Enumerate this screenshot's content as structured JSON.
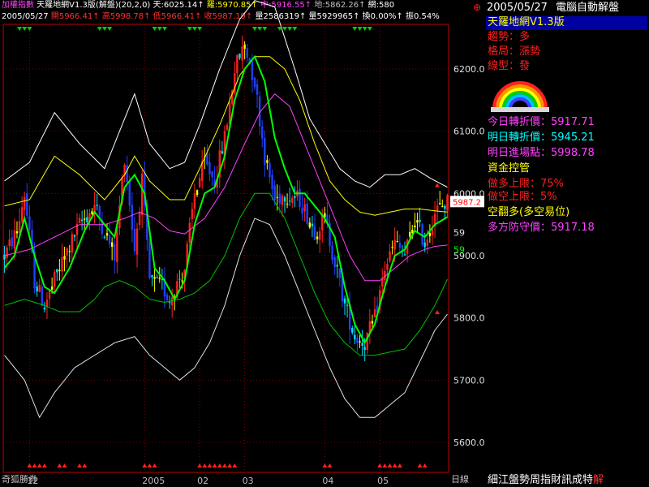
{
  "header": {
    "row1": [
      {
        "text": "加權指數",
        "cls": "c-mag"
      },
      {
        "text": " 天羅地網V1.3版(解盤)(20,2,0) ",
        "cls": "t"
      },
      {
        "text": "天:6025.14↑ ",
        "cls": "t"
      },
      {
        "text": "羅:5970.85↑ ",
        "cls": "c-yel"
      },
      {
        "text": "中:5916.55↑ ",
        "cls": "c-mag"
      },
      {
        "text": "地:5862.26↑ ",
        "cls": "c-gry"
      },
      {
        "text": "網:580",
        "cls": "t"
      }
    ],
    "row2": [
      {
        "text": "2005/05/27 ",
        "cls": "t"
      },
      {
        "text": "開5966.41↑ 高5998.78↑ 低5966.41↑ 收5987.19↑ ",
        "cls": "c-red"
      },
      {
        "text": "量2586319↑ 量5929965↑ 換0.00%↑ 振0.54%",
        "cls": "t"
      }
    ]
  },
  "panel": {
    "date": "2005/05/27",
    "brand": "電腦自動解盤",
    "title": "天羅地網V1.3版",
    "trend": "趨勢：多",
    "pattern": "格局：漲勢",
    "line_type": "線型：發",
    "today_turn": "今日轉折價：5917.71",
    "tomorrow_turn": "明日轉折價：5945.21",
    "tomorrow_entry": "明日進場點：5998.78",
    "capital": "資金控管",
    "long_limit": "做多上限：75%",
    "short_limit": "做空上限：5%",
    "flip": "空翻多(多空易位)",
    "defense": "多方防守價：5917.18"
  },
  "footer": {
    "left": "奇狐勝券",
    "unit": "日線",
    "slogan": "細江盤勢周指財訊成特",
    "slogan_last": "解"
  },
  "colors": {
    "up": "#ff2020",
    "down": "#2040ff",
    "doji_up": "#ffff00",
    "doji_down": "#00e0ff",
    "grid": "#800000",
    "axis": "#c00000"
  },
  "chart_data": {
    "type": "line",
    "title": "",
    "xlabel": "",
    "ylabel": "",
    "ylim": [
      5560,
      6260
    ],
    "yticks": [
      5600,
      5700,
      5800,
      5900,
      6000,
      6100,
      6200
    ],
    "ytick_labels": [
      "5600.0",
      "5700.0",
      "5800.0",
      "5900.0",
      "6000.0",
      "6100.0",
      "6200.0"
    ],
    "xticks": [
      {
        "index": 10,
        "label": "12"
      },
      {
        "index": 56,
        "label": "2005"
      },
      {
        "index": 78,
        "label": "02"
      },
      {
        "index": 96,
        "label": "03"
      },
      {
        "index": 128,
        "label": "04"
      },
      {
        "index": 150,
        "label": "05"
      }
    ],
    "n_bars": 178,
    "last_close_label": "5987.2",
    "right_labels": [
      {
        "value": 5937,
        "text": "59"
      },
      {
        "value": 5910,
        "text": "59"
      }
    ],
    "anchors": [
      [
        0,
        5900
      ],
      [
        5,
        5940
      ],
      [
        8,
        6000
      ],
      [
        12,
        5860
      ],
      [
        16,
        5820
      ],
      [
        22,
        5880
      ],
      [
        30,
        5950
      ],
      [
        36,
        5980
      ],
      [
        44,
        5900
      ],
      [
        48,
        6060
      ],
      [
        52,
        5910
      ],
      [
        55,
        6020
      ],
      [
        58,
        5860
      ],
      [
        63,
        5850
      ],
      [
        66,
        5830
      ],
      [
        72,
        5880
      ],
      [
        76,
        6000
      ],
      [
        80,
        6050
      ],
      [
        84,
        6020
      ],
      [
        88,
        6090
      ],
      [
        92,
        6200
      ],
      [
        96,
        6240
      ],
      [
        100,
        6180
      ],
      [
        104,
        6060
      ],
      [
        108,
        5990
      ],
      [
        112,
        6000
      ],
      [
        118,
        5990
      ],
      [
        124,
        5940
      ],
      [
        128,
        5960
      ],
      [
        132,
        5890
      ],
      [
        136,
        5820
      ],
      [
        140,
        5770
      ],
      [
        144,
        5760
      ],
      [
        148,
        5800
      ],
      [
        152,
        5880
      ],
      [
        156,
        5920
      ],
      [
        160,
        5900
      ],
      [
        164,
        5960
      ],
      [
        168,
        5920
      ],
      [
        172,
        5970
      ],
      [
        177,
        5987
      ]
    ],
    "series": [
      {
        "name": "天",
        "color": "#ffffff",
        "points": [
          [
            0,
            6020
          ],
          [
            10,
            6050
          ],
          [
            20,
            6130
          ],
          [
            30,
            6080
          ],
          [
            40,
            6040
          ],
          [
            48,
            6120
          ],
          [
            52,
            6160
          ],
          [
            58,
            6080
          ],
          [
            66,
            6040
          ],
          [
            72,
            6050
          ],
          [
            78,
            6110
          ],
          [
            86,
            6200
          ],
          [
            94,
            6280
          ],
          [
            100,
            6310
          ],
          [
            108,
            6300
          ],
          [
            116,
            6200
          ],
          [
            122,
            6120
          ],
          [
            128,
            6080
          ],
          [
            134,
            6040
          ],
          [
            140,
            6020
          ],
          [
            146,
            6010
          ],
          [
            152,
            6030
          ],
          [
            158,
            6030
          ],
          [
            164,
            6040
          ],
          [
            170,
            6025
          ],
          [
            177,
            6010
          ]
        ]
      },
      {
        "name": "羅",
        "color": "#ffff00",
        "points": [
          [
            0,
            5980
          ],
          [
            10,
            5990
          ],
          [
            20,
            6060
          ],
          [
            30,
            6030
          ],
          [
            40,
            5990
          ],
          [
            48,
            6030
          ],
          [
            52,
            6060
          ],
          [
            58,
            6020
          ],
          [
            66,
            5990
          ],
          [
            72,
            5990
          ],
          [
            78,
            6040
          ],
          [
            86,
            6110
          ],
          [
            94,
            6190
          ],
          [
            100,
            6220
          ],
          [
            106,
            6220
          ],
          [
            112,
            6200
          ],
          [
            118,
            6150
          ],
          [
            124,
            6080
          ],
          [
            130,
            6020
          ],
          [
            136,
            5990
          ],
          [
            142,
            5970
          ],
          [
            148,
            5965
          ],
          [
            154,
            5970
          ],
          [
            160,
            5975
          ],
          [
            166,
            5975
          ],
          [
            172,
            5972
          ],
          [
            177,
            5970
          ]
        ]
      },
      {
        "name": "中",
        "color": "#ff40ff",
        "points": [
          [
            0,
            5900
          ],
          [
            10,
            5910
          ],
          [
            20,
            5930
          ],
          [
            30,
            5950
          ],
          [
            40,
            5950
          ],
          [
            48,
            5960
          ],
          [
            54,
            5970
          ],
          [
            60,
            5960
          ],
          [
            66,
            5940
          ],
          [
            72,
            5935
          ],
          [
            80,
            5960
          ],
          [
            88,
            6010
          ],
          [
            96,
            6080
          ],
          [
            102,
            6130
          ],
          [
            108,
            6160
          ],
          [
            114,
            6140
          ],
          [
            120,
            6080
          ],
          [
            126,
            6020
          ],
          [
            132,
            5960
          ],
          [
            138,
            5900
          ],
          [
            144,
            5860
          ],
          [
            150,
            5860
          ],
          [
            156,
            5880
          ],
          [
            162,
            5900
          ],
          [
            168,
            5910
          ],
          [
            172,
            5915
          ],
          [
            177,
            5917
          ]
        ]
      },
      {
        "name": "地",
        "color": "#00c000",
        "points": [
          [
            0,
            5820
          ],
          [
            8,
            5830
          ],
          [
            16,
            5820
          ],
          [
            22,
            5810
          ],
          [
            30,
            5810
          ],
          [
            36,
            5830
          ],
          [
            40,
            5850
          ],
          [
            46,
            5860
          ],
          [
            52,
            5850
          ],
          [
            58,
            5830
          ],
          [
            64,
            5825
          ],
          [
            70,
            5830
          ],
          [
            76,
            5840
          ],
          [
            82,
            5860
          ],
          [
            88,
            5900
          ],
          [
            94,
            5960
          ],
          [
            100,
            6000
          ],
          [
            106,
            6000
          ],
          [
            112,
            5960
          ],
          [
            118,
            5900
          ],
          [
            124,
            5840
          ],
          [
            130,
            5790
          ],
          [
            136,
            5760
          ],
          [
            142,
            5740
          ],
          [
            148,
            5740
          ],
          [
            154,
            5745
          ],
          [
            160,
            5750
          ],
          [
            166,
            5780
          ],
          [
            172,
            5820
          ],
          [
            177,
            5862
          ]
        ]
      },
      {
        "name": "網",
        "color": "#e0e0e0",
        "points": [
          [
            0,
            5740
          ],
          [
            8,
            5700
          ],
          [
            14,
            5640
          ],
          [
            20,
            5680
          ],
          [
            28,
            5720
          ],
          [
            36,
            5740
          ],
          [
            44,
            5760
          ],
          [
            52,
            5770
          ],
          [
            58,
            5740
          ],
          [
            64,
            5720
          ],
          [
            70,
            5700
          ],
          [
            76,
            5720
          ],
          [
            82,
            5760
          ],
          [
            88,
            5820
          ],
          [
            94,
            5900
          ],
          [
            100,
            5960
          ],
          [
            106,
            5950
          ],
          [
            112,
            5900
          ],
          [
            118,
            5840
          ],
          [
            124,
            5780
          ],
          [
            130,
            5720
          ],
          [
            136,
            5670
          ],
          [
            142,
            5640
          ],
          [
            148,
            5640
          ],
          [
            154,
            5660
          ],
          [
            160,
            5680
          ],
          [
            166,
            5730
          ],
          [
            172,
            5780
          ],
          [
            177,
            5806
          ]
        ]
      },
      {
        "name": "",
        "color": "#00ff00",
        "width": 2,
        "points": [
          [
            0,
            5880
          ],
          [
            4,
            5900
          ],
          [
            8,
            5960
          ],
          [
            12,
            5900
          ],
          [
            16,
            5850
          ],
          [
            20,
            5840
          ],
          [
            26,
            5880
          ],
          [
            32,
            5940
          ],
          [
            36,
            5970
          ],
          [
            40,
            5950
          ],
          [
            44,
            5930
          ],
          [
            48,
            6010
          ],
          [
            52,
            6030
          ],
          [
            56,
            6000
          ],
          [
            60,
            5880
          ],
          [
            64,
            5860
          ],
          [
            68,
            5830
          ],
          [
            72,
            5860
          ],
          [
            76,
            5950
          ],
          [
            80,
            6000
          ],
          [
            84,
            6010
          ],
          [
            88,
            6060
          ],
          [
            92,
            6150
          ],
          [
            96,
            6200
          ],
          [
            100,
            6220
          ],
          [
            104,
            6180
          ],
          [
            108,
            6090
          ],
          [
            112,
            6040
          ],
          [
            116,
            6000
          ],
          [
            120,
            6000
          ],
          [
            124,
            5980
          ],
          [
            128,
            5960
          ],
          [
            132,
            5930
          ],
          [
            136,
            5850
          ],
          [
            140,
            5790
          ],
          [
            144,
            5760
          ],
          [
            148,
            5790
          ],
          [
            152,
            5850
          ],
          [
            156,
            5900
          ],
          [
            160,
            5910
          ],
          [
            164,
            5940
          ],
          [
            168,
            5930
          ],
          [
            172,
            5950
          ],
          [
            177,
            5962
          ]
        ]
      }
    ]
  }
}
